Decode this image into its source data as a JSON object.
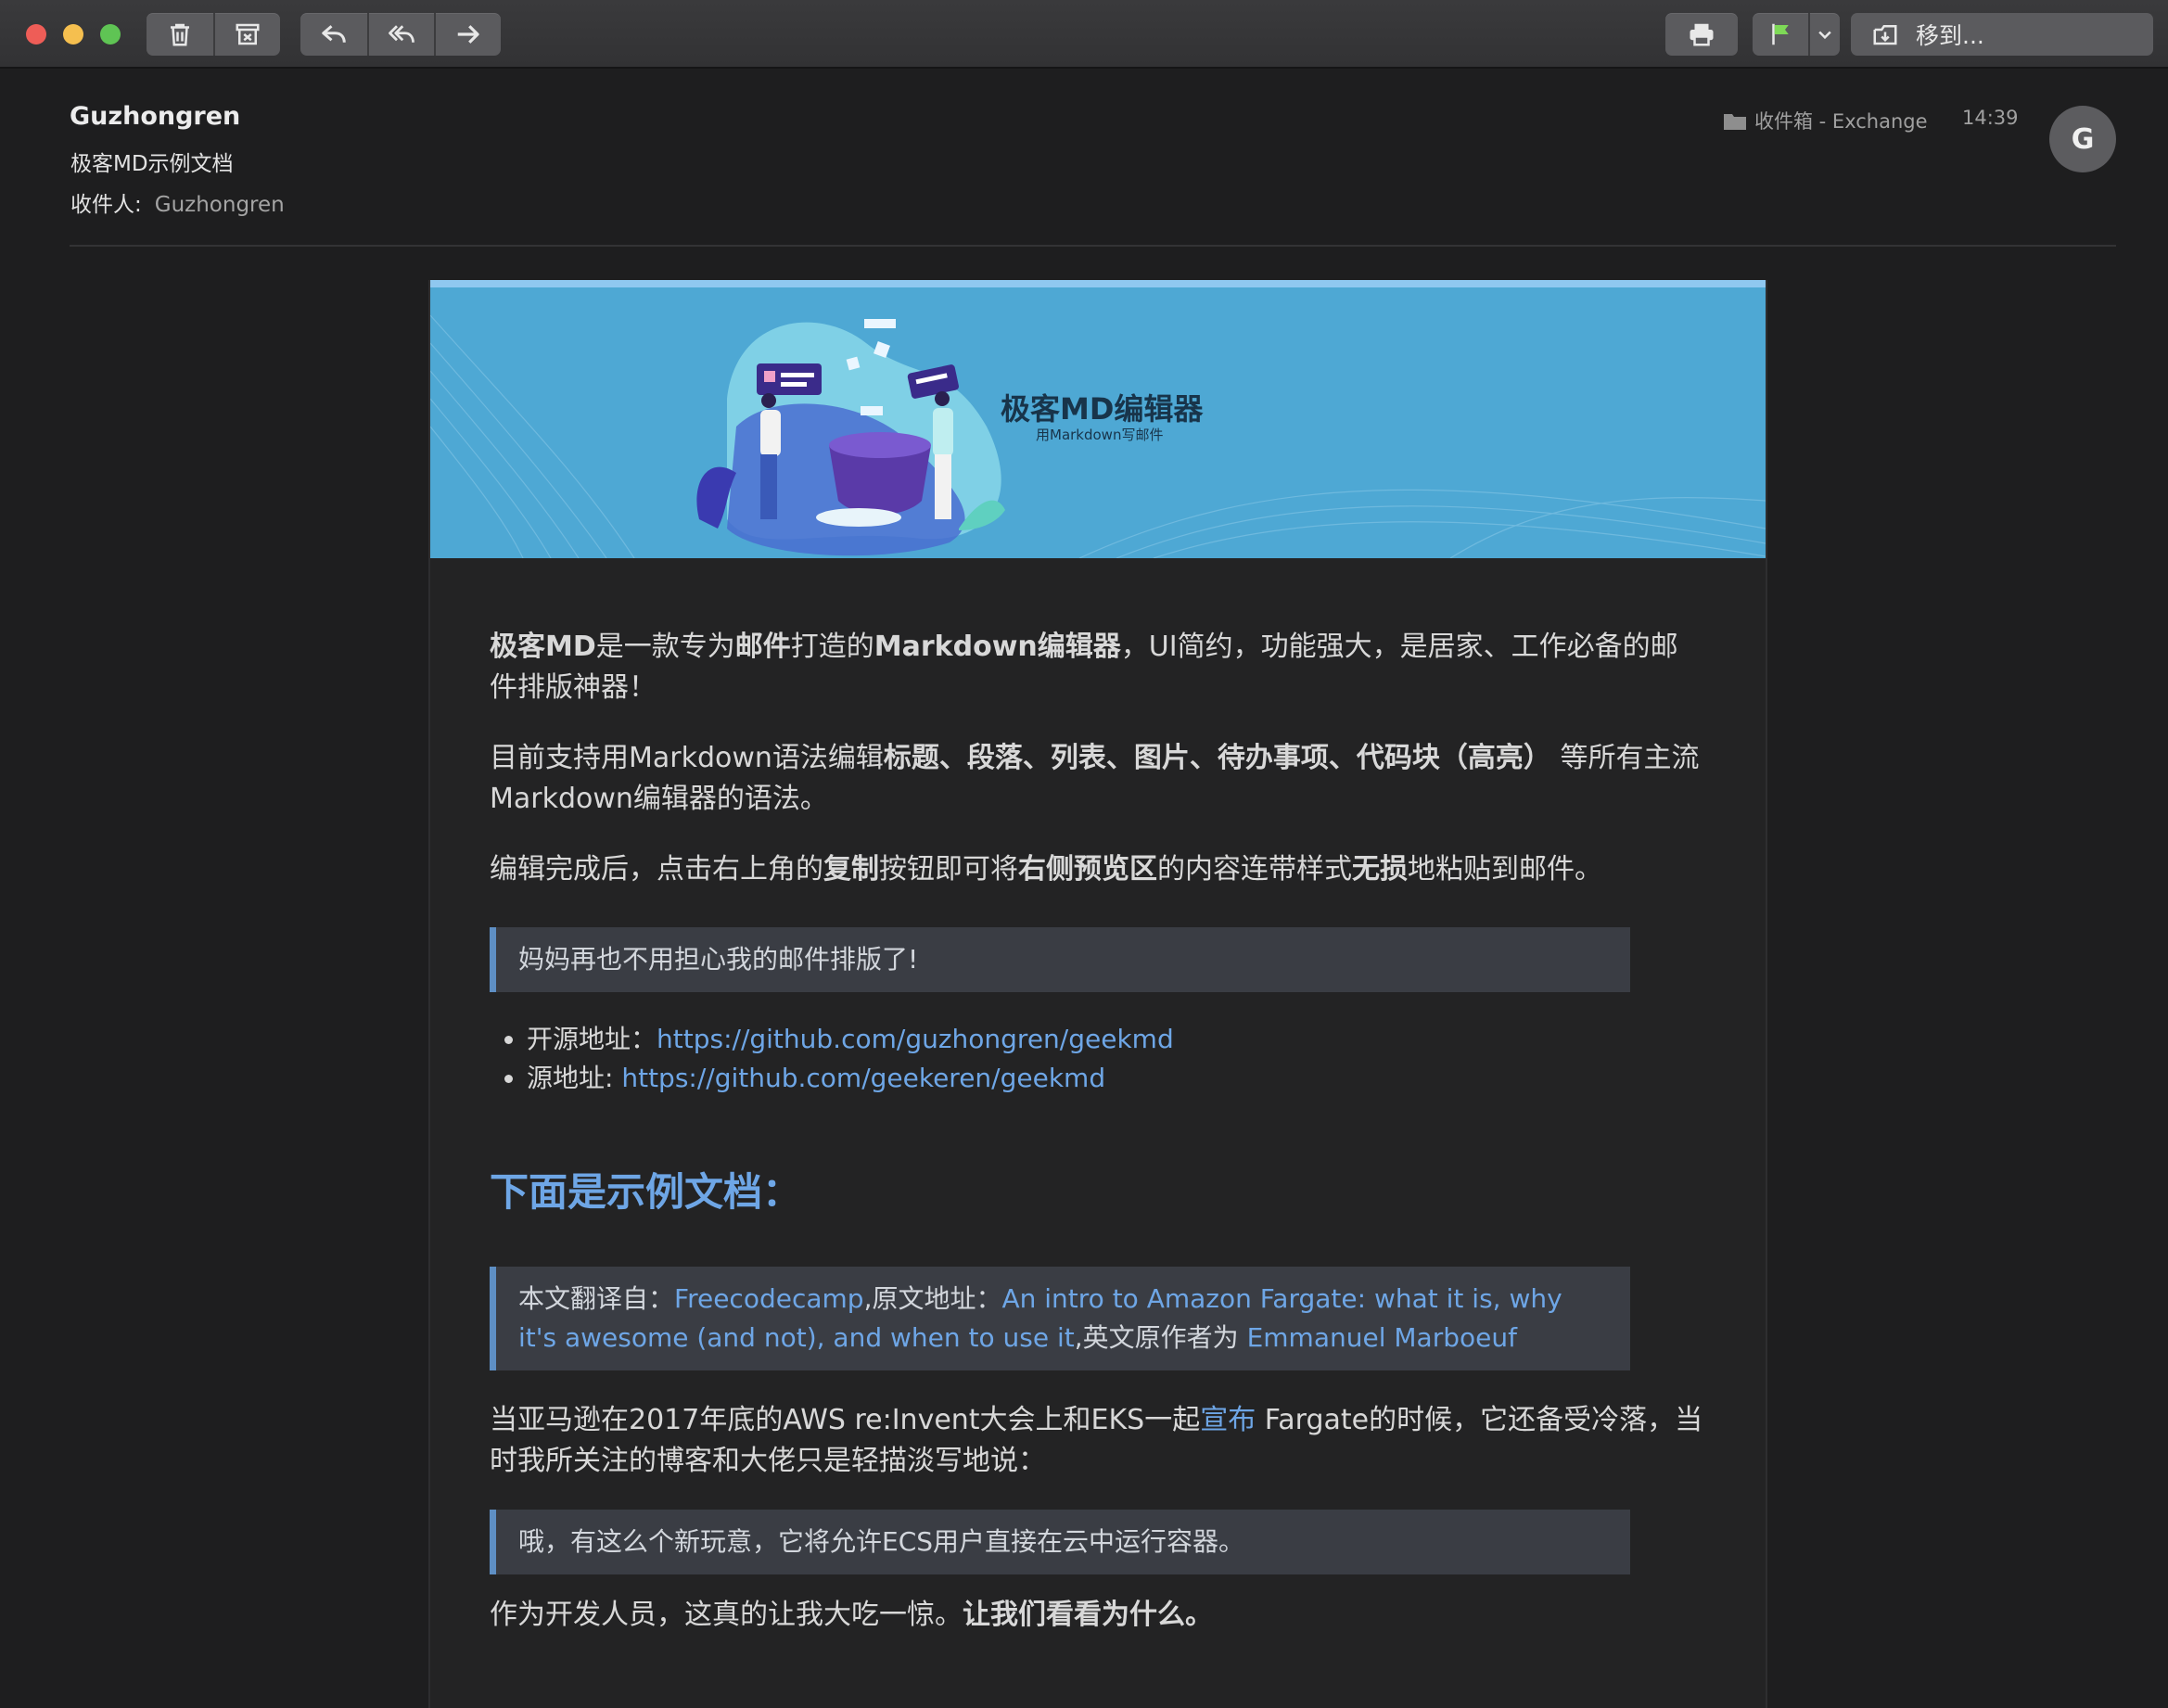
{
  "toolbar": {
    "move_to_label": "移到..."
  },
  "header": {
    "sender": "Guzhongren",
    "subject": "极客MD示例文档",
    "recipient_label": "收件人:",
    "recipient_name": "Guzhongren",
    "folder": "收件箱 - Exchange",
    "time": "14:39",
    "avatar_initial": "G"
  },
  "banner": {
    "title": "极客MD编辑器",
    "subtitle": "用Markdown写邮件"
  },
  "body": {
    "p1": {
      "a": "极客MD",
      "b": "是一款专为",
      "c": "邮件",
      "d": "打造的",
      "e": "Markdown编辑器",
      "f": "，UI简约，功能强大，是居家、工作必备的邮件排版神器！"
    },
    "p2": {
      "a": "目前支持用Markdown语法编辑",
      "b": "标题、段落、列表、图片、待办事项、代码块（高亮）",
      "c": " 等所有主流Markdown编辑器的语法。"
    },
    "p3": {
      "a": "编辑完成后，点击右上角的",
      "b": "复制",
      "c": "按钮即可将",
      "d": "右侧预览区",
      "e": "的内容连带样式",
      "f": "无损",
      "g": "地粘贴到邮件。"
    },
    "quote1": "妈妈再也不用担心我的邮件排版了!",
    "links": [
      {
        "label": "开源地址：",
        "url": "https://github.com/guzhongren/geekmd"
      },
      {
        "label": "源地址: ",
        "url": "https://github.com/geekeren/geekmd"
      }
    ],
    "heading": "下面是示例文档：",
    "quote2": {
      "a": "本文翻译自：",
      "b": "Freecodecamp",
      "c": ",原文地址：",
      "d": "An intro to Amazon Fargate: what it is, why it's awesome (and not), and when to use it",
      "e": ",英文原作者为 ",
      "f": "Emmanuel Marboeuf"
    },
    "p4": {
      "a": "当亚马逊在2017年底的AWS re:Invent大会上和EKS一起",
      "b": "宣布",
      "c": " Fargate的时候，它还备受冷落，当时我所关注的博客和大佬只是轻描淡写地说："
    },
    "quote3": "哦，有这么个新玩意，它将允许ECS用户直接在云中运行容器。",
    "p5": {
      "a": "作为开发人员，这真的让我大吃一惊。",
      "b": "让我们看看为什么。"
    }
  },
  "colors": {
    "background": "#1e1e1f",
    "banner": "#4ea8d4",
    "link": "#6ea6e6",
    "quote_bg": "#3a3d44",
    "quote_border": "#5e8fc4",
    "flag": "#7ed957"
  }
}
